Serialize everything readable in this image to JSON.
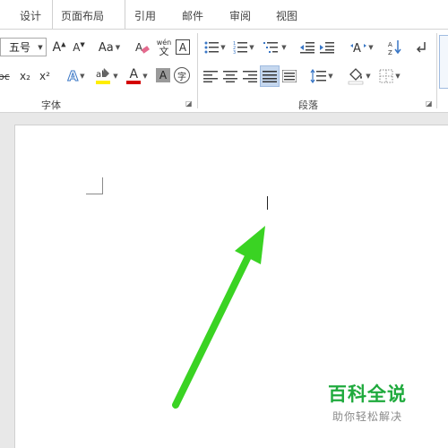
{
  "tabs": [
    {
      "label": "设计"
    },
    {
      "label": "页面布局"
    },
    {
      "label": "引用"
    },
    {
      "label": "邮件"
    },
    {
      "label": "审阅"
    },
    {
      "label": "视图"
    }
  ],
  "font_group": {
    "label": "字体",
    "font_size": "五号",
    "grow_label": "A",
    "shrink_label": "A",
    "change_case_label": "Aa",
    "phonetic_top": "wén",
    "phonetic_bottom": "文",
    "border_char_label": "A",
    "strike_label": "abc",
    "subscript_label": "x₂",
    "superscript_label": "x²",
    "effects_label": "A",
    "font_color_label": "A",
    "shading_label": "A",
    "enclose_label": "字"
  },
  "paragraph_group": {
    "label": "段落"
  },
  "colors": {
    "highlight": "#ffee00",
    "font_color": "#d40000",
    "arrow": "#3ad323",
    "watermark": "#1faa3d"
  },
  "watermark": {
    "title": "百科全说",
    "subtitle": "助你轻松解决"
  }
}
